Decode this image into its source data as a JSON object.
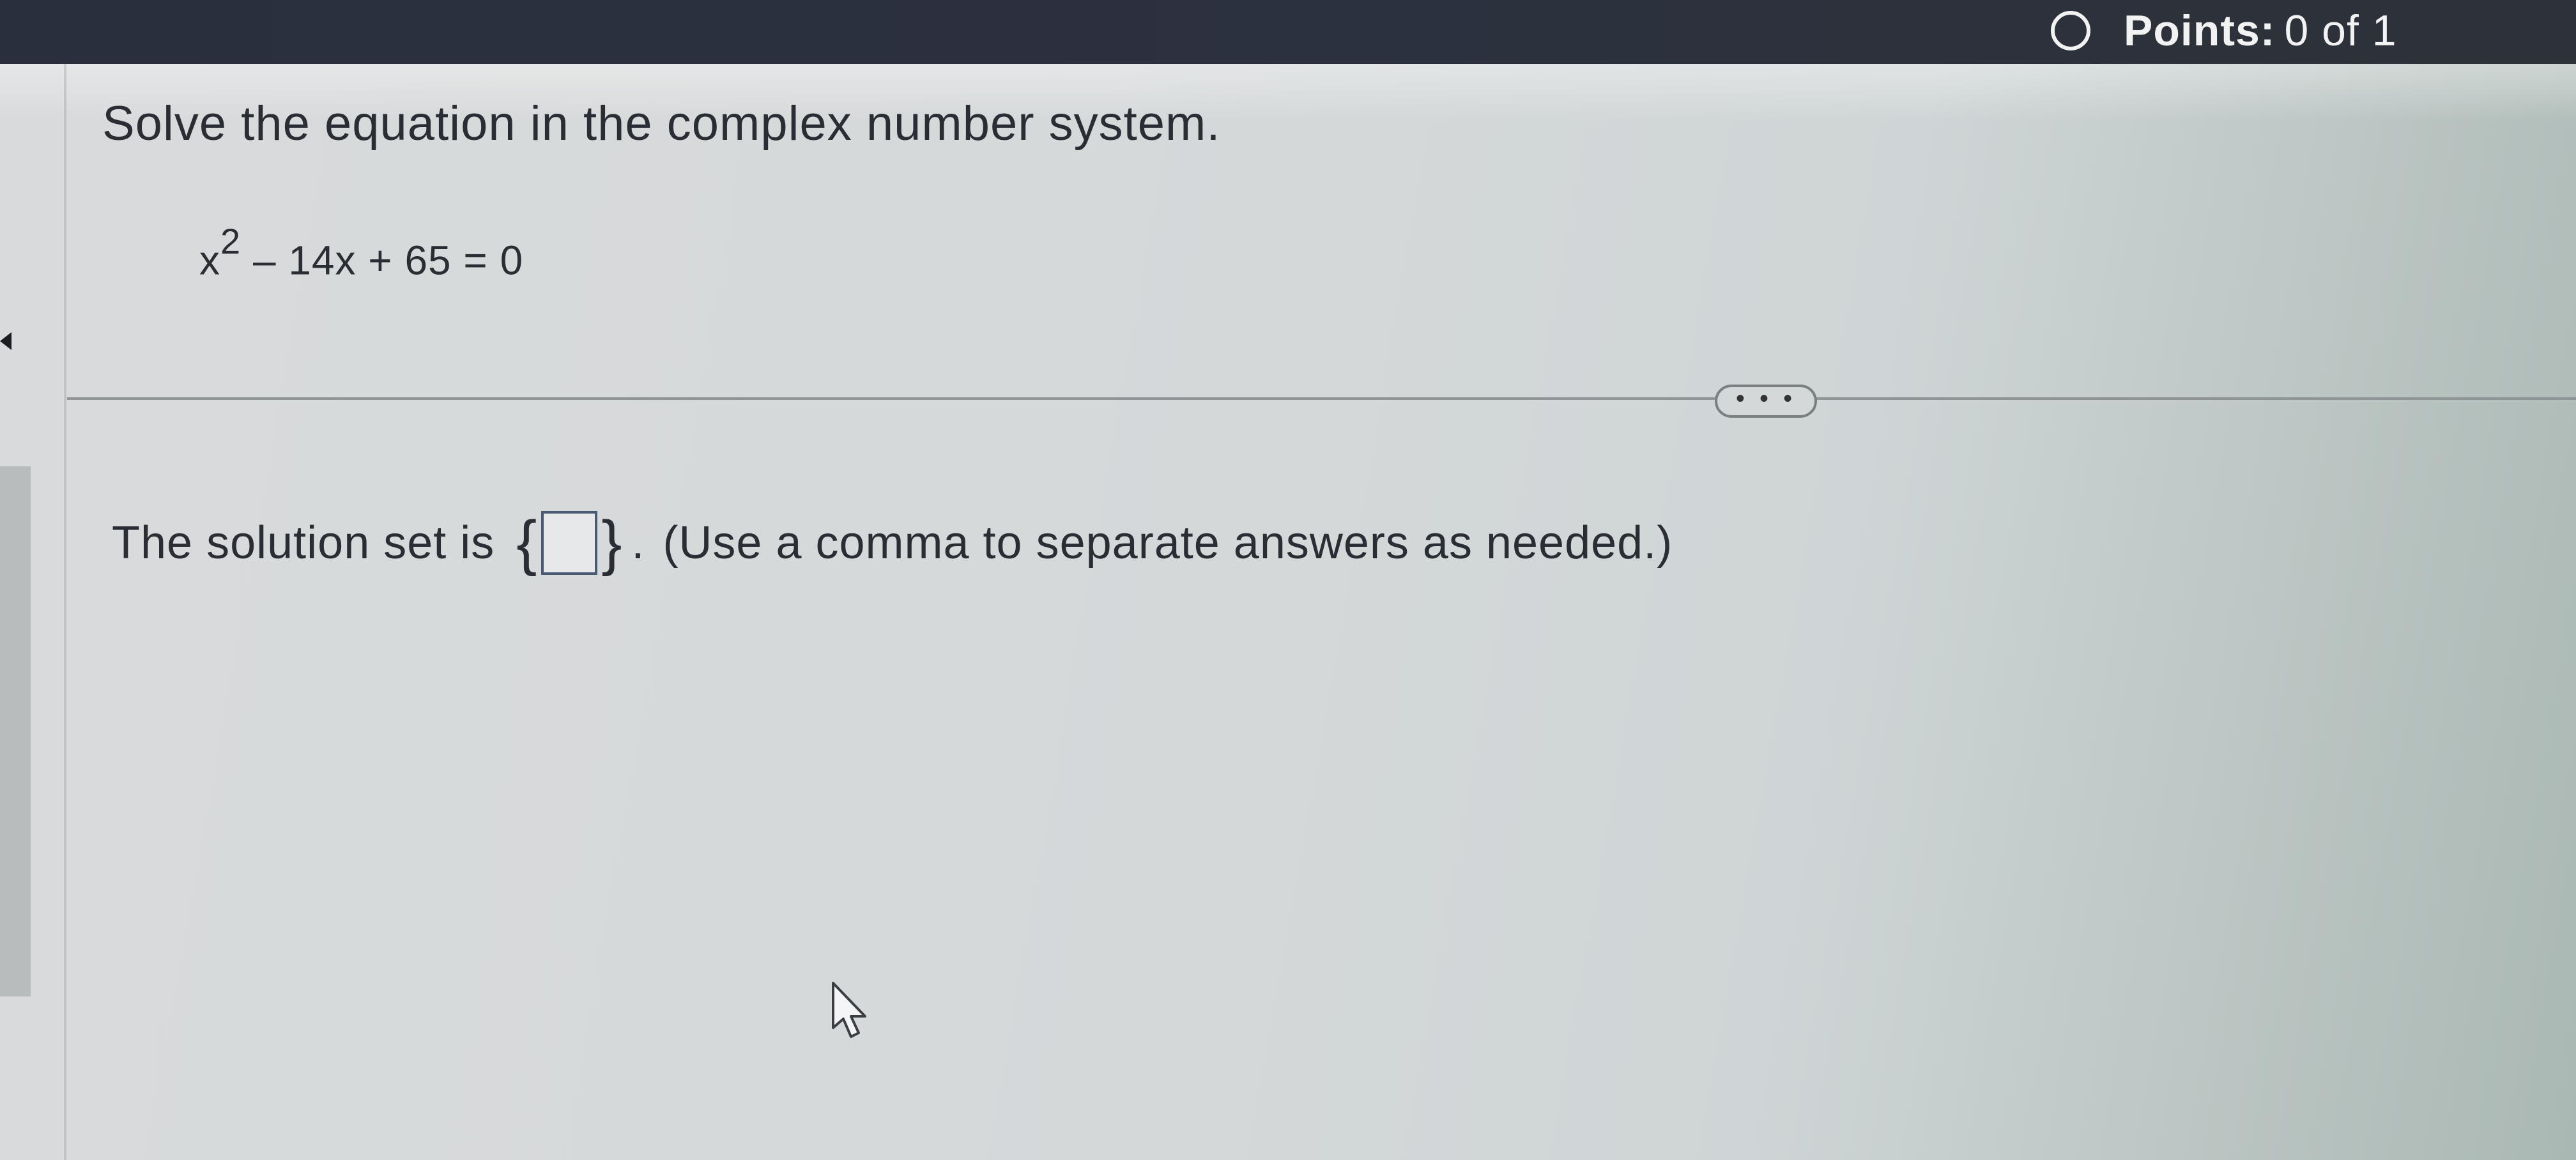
{
  "header": {
    "points_label": "Points:",
    "points_value": "0 of 1"
  },
  "question": {
    "prompt": "Solve the equation in the complex number system.",
    "equation_base": "x",
    "equation_exponent": "2",
    "equation_rest": " – 14x + 65 = 0"
  },
  "more_button": {
    "label": "• • •"
  },
  "answer": {
    "lead_text": "The solution set is",
    "open_brace": "{",
    "close_brace": "}",
    "value": "",
    "period": ".",
    "hint": "(Use a comma to separate answers as needed.)"
  },
  "icons": {
    "status": "circle-outline-icon",
    "cursor": "mouse-pointer-icon"
  }
}
